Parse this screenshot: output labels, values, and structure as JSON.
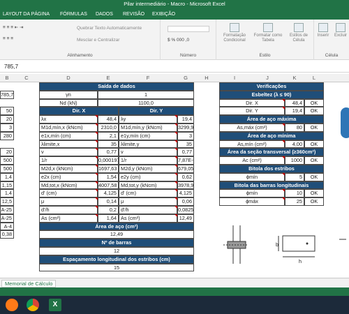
{
  "window": {
    "title": "Pilar intermediário - Macro - Microsoft Excel"
  },
  "tabs": [
    "LAYOUT DA PÁGINA",
    "FÓRMULAS",
    "DADOS",
    "REVISÃO",
    "EXIBIÇÃO"
  ],
  "ribbon": {
    "wrap": "Quebrar Texto Automaticamente",
    "merge": "Mesclar e Centralizar",
    "align_group": "Alinhamento",
    "number_group": "Número",
    "style_group": "Estilo",
    "cells_group": "Célula",
    "cond": "Formatação Condicional",
    "fmt_table": "Formatar como Tabela",
    "cell_styles": "Estilos de Célula",
    "insert": "Inserir",
    "delete": "Excluir"
  },
  "formula_bar": {
    "value": "785,7"
  },
  "columns": [
    "B",
    "C",
    "D",
    "E",
    "F",
    "G",
    "H",
    "I",
    "J",
    "K",
    "L"
  ],
  "left_vals": [
    "785,7",
    "",
    "50",
    "20",
    "3",
    "280",
    "",
    "20",
    "500",
    "500",
    "1,4",
    "1,15",
    "1,4",
    "12,5",
    "A-25",
    "A-25",
    "A-4",
    "0,38"
  ],
  "saida": {
    "title": "Saída de dados",
    "gamma_n": "γn",
    "gamma_val": "1",
    "nd": "Nd (kN)",
    "nd_val": "1100,0",
    "dirx": "Dir. X",
    "diry": "Dir. Y",
    "rows": [
      [
        "λx",
        "48,4",
        "λy",
        "19,4"
      ],
      [
        "M1d,mín,x (kNcm)",
        "2310,0",
        "M1d,mín,y (kNcm)",
        "3299,9"
      ],
      [
        "e1x,mín (cm)",
        "2,1",
        "e1y,mín (cm)",
        "3"
      ],
      [
        "λlimite,x",
        "35",
        "λlimite,y",
        "35"
      ],
      [
        "ν",
        "0,77",
        "ν",
        "0,77"
      ],
      [
        "1/r",
        "0,000197",
        "1/r",
        "7,87E-05"
      ],
      [
        "M2d,x (kNcm)",
        "1697,63",
        "M2d,y (kNcm)",
        "679,05"
      ],
      [
        "e2x (cm)",
        "1,54",
        "e2y (cm)",
        "0,62"
      ],
      [
        "Md,tot,x (kNcm)",
        "4007,58",
        "Md,tot,y (kNcm)",
        "3978,99"
      ],
      [
        "d' (cm)",
        "4,125",
        "d' (cm)",
        "4,125"
      ],
      [
        "μ",
        "0,14",
        "μ",
        "0,06"
      ],
      [
        "d'/h",
        "0,2",
        "d'/h",
        "0,0825"
      ],
      [
        "As (cm²)",
        "1,64",
        "As (cm²)",
        "12,49"
      ]
    ],
    "area_title": "Área de aço (cm²)",
    "area_val": "12,49",
    "barras_title": "Nº de barras",
    "barras_val": "12",
    "esp_title": "Espaçamento longitudinal dos estribos (cm)",
    "esp_val": "15"
  },
  "verif": {
    "title": "Verificações",
    "esbeltez": "Esbeltez (λ ≤ 90)",
    "dirx": "Dir. X",
    "dirx_val": "48,4",
    "diry": "Dir. Y",
    "diry_val": "19,4",
    "ok": "OK",
    "amax_title": "Área de aço máxima",
    "amax": "As,máx (cm²)",
    "amax_val": "80",
    "amin_title": "Área de aço mínima",
    "amin": "As,mín (cm²)",
    "amin_val": "4,00",
    "sec_title": "Área da seção transversal (≥360cm²)",
    "ac": "Ac (cm²)",
    "ac_val": "1000",
    "bitola_title": "Bitola dos estribos",
    "phimin": "ϕmín",
    "phimin_val": "5",
    "bitola_long_title": "Bitola das barras longitudinais",
    "phimin2": "ϕmín",
    "phimin2_val": "10",
    "phimax": "ϕmáx",
    "phimax_val": "25"
  },
  "diagram": {
    "b": "b",
    "h": "h"
  },
  "sheet": {
    "tab": "Memorial de Cálculo"
  },
  "colors": {
    "excel_green": "#217346",
    "header_blue": "#1f4e79"
  }
}
